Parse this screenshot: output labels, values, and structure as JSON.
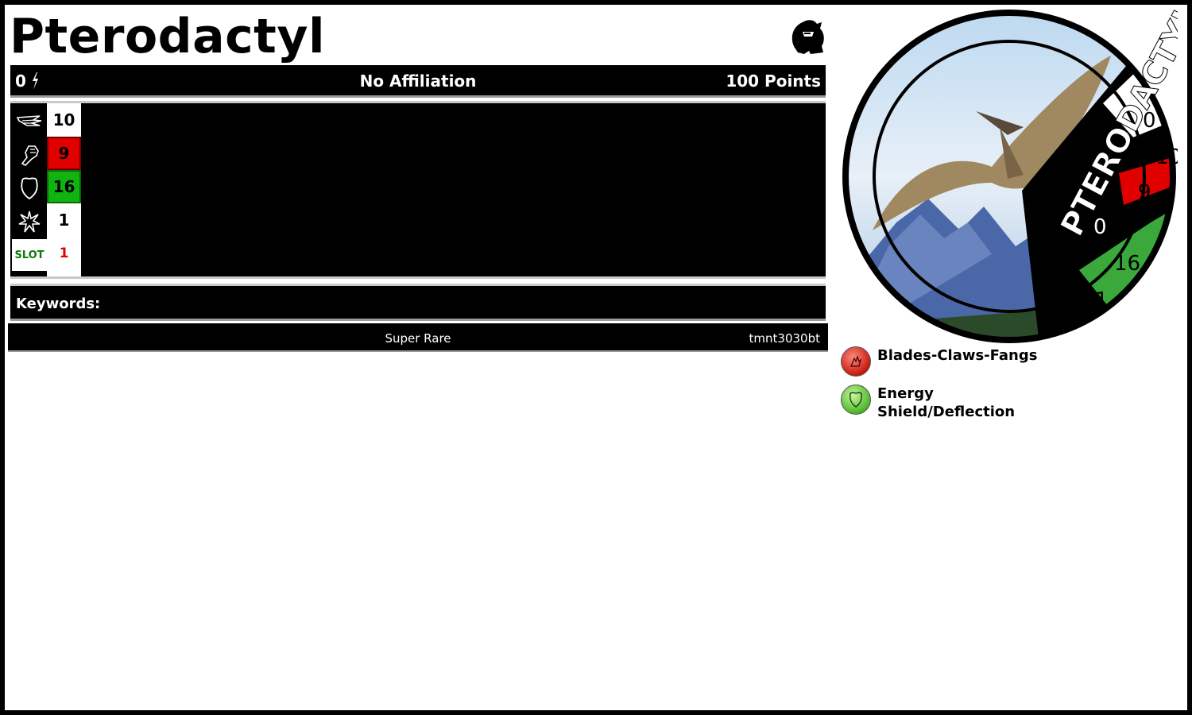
{
  "character": {
    "name": "Pterodactyl",
    "team_icon": "skull-helmet-icon"
  },
  "header": {
    "left_points": "0",
    "left_icon": "lightning-bolt-icon",
    "affiliation": "No Affiliation",
    "points": "100 Points"
  },
  "combat_values": [
    {
      "icon": "speed-wing-icon",
      "value": "10",
      "style": "plain"
    },
    {
      "icon": "attack-fist-icon",
      "value": "9",
      "style": "red"
    },
    {
      "icon": "defense-shield-icon",
      "value": "16",
      "style": "green"
    },
    {
      "icon": "damage-starburst-icon",
      "value": "1",
      "style": "plain"
    },
    {
      "icon_text": "SLOT",
      "value": "1",
      "style": "red-text"
    }
  ],
  "keywords": {
    "label": "Keywords:"
  },
  "footer": {
    "rarity": "Super Rare",
    "set_code": "tmnt3030bt"
  },
  "dial": {
    "name": "PTERODACTYL",
    "values": [
      "0",
      "10",
      "9",
      "0",
      "16",
      "1"
    ],
    "colors": {
      "red": "#e10000",
      "green": "#3aa83a"
    }
  },
  "powers": [
    {
      "name": "Blades-Claws-Fangs",
      "color": "red",
      "icon": "claw-icon"
    },
    {
      "name": "Energy Shield/Deflection",
      "color": "green",
      "icon": "shield-icon"
    }
  ]
}
